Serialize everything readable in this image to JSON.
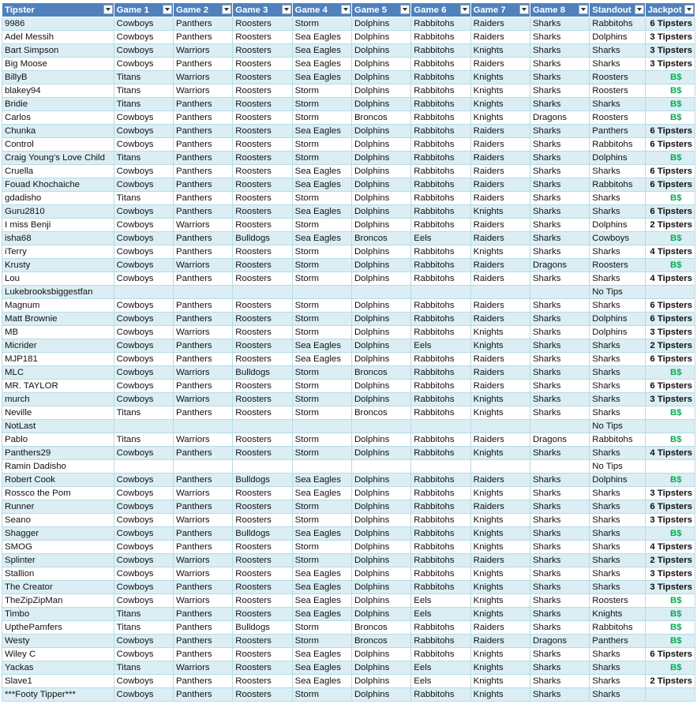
{
  "headers": [
    "Tipster",
    "Game 1",
    "Game 2",
    "Game 3",
    "Game 4",
    "Game 5",
    "Game 6",
    "Game 7",
    "Game 8",
    "Standout",
    "Jackpot"
  ],
  "rows": [
    [
      "9986",
      "Cowboys",
      "Panthers",
      "Roosters",
      "Storm",
      "Dolphins",
      "Rabbitohs",
      "Raiders",
      "Sharks",
      "Rabbitohs",
      "6 Tipsters"
    ],
    [
      "Adel Messih",
      "Cowboys",
      "Panthers",
      "Roosters",
      "Sea Eagles",
      "Dolphins",
      "Rabbitohs",
      "Raiders",
      "Sharks",
      "Dolphins",
      "3 Tipsters"
    ],
    [
      "Bart Simpson",
      "Cowboys",
      "Warriors",
      "Roosters",
      "Sea Eagles",
      "Dolphins",
      "Rabbitohs",
      "Knights",
      "Sharks",
      "Sharks",
      "3 Tipsters"
    ],
    [
      "Big Moose",
      "Cowboys",
      "Panthers",
      "Roosters",
      "Sea Eagles",
      "Dolphins",
      "Rabbitohs",
      "Raiders",
      "Sharks",
      "Sharks",
      "3 Tipsters"
    ],
    [
      "BillyB",
      "Titans",
      "Warriors",
      "Roosters",
      "Sea Eagles",
      "Dolphins",
      "Rabbitohs",
      "Knights",
      "Sharks",
      "Roosters",
      "B$"
    ],
    [
      "blakey94",
      "Titans",
      "Warriors",
      "Roosters",
      "Storm",
      "Dolphins",
      "Rabbitohs",
      "Knights",
      "Sharks",
      "Roosters",
      "B$"
    ],
    [
      "Bridie",
      "Titans",
      "Panthers",
      "Roosters",
      "Storm",
      "Dolphins",
      "Rabbitohs",
      "Knights",
      "Sharks",
      "Sharks",
      "B$"
    ],
    [
      "Carlos",
      "Cowboys",
      "Panthers",
      "Roosters",
      "Storm",
      "Broncos",
      "Rabbitohs",
      "Knights",
      "Dragons",
      "Roosters",
      "B$"
    ],
    [
      "Chunka",
      "Cowboys",
      "Panthers",
      "Roosters",
      "Sea Eagles",
      "Dolphins",
      "Rabbitohs",
      "Raiders",
      "Sharks",
      "Panthers",
      "6 Tipsters"
    ],
    [
      "Control",
      "Cowboys",
      "Panthers",
      "Roosters",
      "Storm",
      "Dolphins",
      "Rabbitohs",
      "Raiders",
      "Sharks",
      "Rabbitohs",
      "6 Tipsters"
    ],
    [
      "Craig Young's Love Child",
      "Titans",
      "Panthers",
      "Roosters",
      "Storm",
      "Dolphins",
      "Rabbitohs",
      "Raiders",
      "Sharks",
      "Dolphins",
      "B$"
    ],
    [
      "Cruella",
      "Cowboys",
      "Panthers",
      "Roosters",
      "Sea Eagles",
      "Dolphins",
      "Rabbitohs",
      "Raiders",
      "Sharks",
      "Sharks",
      "6 Tipsters"
    ],
    [
      "Fouad Khochaiche",
      "Cowboys",
      "Panthers",
      "Roosters",
      "Sea Eagles",
      "Dolphins",
      "Rabbitohs",
      "Raiders",
      "Sharks",
      "Rabbitohs",
      "6 Tipsters"
    ],
    [
      "gdadisho",
      "Titans",
      "Panthers",
      "Roosters",
      "Storm",
      "Dolphins",
      "Rabbitohs",
      "Raiders",
      "Sharks",
      "Sharks",
      "B$"
    ],
    [
      "Guru2810",
      "Cowboys",
      "Panthers",
      "Roosters",
      "Sea Eagles",
      "Dolphins",
      "Rabbitohs",
      "Knights",
      "Sharks",
      "Sharks",
      "6 Tipsters"
    ],
    [
      "I miss Benji",
      "Cowboys",
      "Warriors",
      "Roosters",
      "Storm",
      "Dolphins",
      "Rabbitohs",
      "Raiders",
      "Sharks",
      "Dolphins",
      "2 Tipsters"
    ],
    [
      "isha68",
      "Cowboys",
      "Panthers",
      "Bulldogs",
      "Sea Eagles",
      "Broncos",
      "Eels",
      "Raiders",
      "Sharks",
      "Cowboys",
      "B$"
    ],
    [
      "iTerry",
      "Cowboys",
      "Panthers",
      "Roosters",
      "Storm",
      "Dolphins",
      "Rabbitohs",
      "Knights",
      "Sharks",
      "Sharks",
      "4 Tipsters"
    ],
    [
      "Krusty",
      "Cowboys",
      "Warriors",
      "Roosters",
      "Storm",
      "Dolphins",
      "Rabbitohs",
      "Raiders",
      "Dragons",
      "Roosters",
      "B$"
    ],
    [
      "Lou",
      "Cowboys",
      "Panthers",
      "Roosters",
      "Storm",
      "Dolphins",
      "Rabbitohs",
      "Raiders",
      "Sharks",
      "Sharks",
      "4 Tipsters"
    ],
    [
      "Lukebrooksbiggestfan",
      "",
      "",
      "",
      "",
      "",
      "",
      "",
      "",
      "No Tips",
      ""
    ],
    [
      "Magnum",
      "Cowboys",
      "Panthers",
      "Roosters",
      "Storm",
      "Dolphins",
      "Rabbitohs",
      "Raiders",
      "Sharks",
      "Sharks",
      "6 Tipsters"
    ],
    [
      "Matt Brownie",
      "Cowboys",
      "Panthers",
      "Roosters",
      "Storm",
      "Dolphins",
      "Rabbitohs",
      "Raiders",
      "Sharks",
      "Dolphins",
      "6 Tipsters"
    ],
    [
      "MB",
      "Cowboys",
      "Warriors",
      "Roosters",
      "Storm",
      "Dolphins",
      "Rabbitohs",
      "Knights",
      "Sharks",
      "Dolphins",
      "3 Tipsters"
    ],
    [
      "Micrider",
      "Cowboys",
      "Panthers",
      "Roosters",
      "Sea Eagles",
      "Dolphins",
      "Eels",
      "Knights",
      "Sharks",
      "Sharks",
      "2 Tipsters"
    ],
    [
      "MJP181",
      "Cowboys",
      "Panthers",
      "Roosters",
      "Sea Eagles",
      "Dolphins",
      "Rabbitohs",
      "Raiders",
      "Sharks",
      "Sharks",
      "6 Tipsters"
    ],
    [
      "MLC",
      "Cowboys",
      "Warriors",
      "Bulldogs",
      "Storm",
      "Broncos",
      "Rabbitohs",
      "Raiders",
      "Sharks",
      "Sharks",
      "B$"
    ],
    [
      "MR. TAYLOR",
      "Cowboys",
      "Panthers",
      "Roosters",
      "Storm",
      "Dolphins",
      "Rabbitohs",
      "Raiders",
      "Sharks",
      "Sharks",
      "6 Tipsters"
    ],
    [
      "murch",
      "Cowboys",
      "Warriors",
      "Roosters",
      "Storm",
      "Dolphins",
      "Rabbitohs",
      "Knights",
      "Sharks",
      "Sharks",
      "3 Tipsters"
    ],
    [
      "Neville",
      "Titans",
      "Panthers",
      "Roosters",
      "Storm",
      "Broncos",
      "Rabbitohs",
      "Knights",
      "Sharks",
      "Sharks",
      "B$"
    ],
    [
      "NotLast",
      "",
      "",
      "",
      "",
      "",
      "",
      "",
      "",
      "No Tips",
      ""
    ],
    [
      "Pablo",
      "Titans",
      "Warriors",
      "Roosters",
      "Storm",
      "Dolphins",
      "Rabbitohs",
      "Raiders",
      "Dragons",
      "Rabbitohs",
      "B$"
    ],
    [
      "Panthers29",
      "Cowboys",
      "Panthers",
      "Roosters",
      "Storm",
      "Dolphins",
      "Rabbitohs",
      "Knights",
      "Sharks",
      "Sharks",
      "4 Tipsters"
    ],
    [
      "Ramin Dadisho",
      "",
      "",
      "",
      "",
      "",
      "",
      "",
      "",
      "No Tips",
      ""
    ],
    [
      "Robert Cook",
      "Cowboys",
      "Panthers",
      "Bulldogs",
      "Sea Eagles",
      "Dolphins",
      "Rabbitohs",
      "Raiders",
      "Sharks",
      "Dolphins",
      "B$"
    ],
    [
      "Rossco the Pom",
      "Cowboys",
      "Warriors",
      "Roosters",
      "Sea Eagles",
      "Dolphins",
      "Rabbitohs",
      "Knights",
      "Sharks",
      "Sharks",
      "3 Tipsters"
    ],
    [
      "Runner",
      "Cowboys",
      "Panthers",
      "Roosters",
      "Storm",
      "Dolphins",
      "Rabbitohs",
      "Raiders",
      "Sharks",
      "Sharks",
      "6 Tipsters"
    ],
    [
      "Seano",
      "Cowboys",
      "Warriors",
      "Roosters",
      "Storm",
      "Dolphins",
      "Rabbitohs",
      "Knights",
      "Sharks",
      "Sharks",
      "3 Tipsters"
    ],
    [
      "Shagger",
      "Cowboys",
      "Panthers",
      "Bulldogs",
      "Sea Eagles",
      "Dolphins",
      "Rabbitohs",
      "Knights",
      "Sharks",
      "Sharks",
      "B$"
    ],
    [
      "SMOG",
      "Cowboys",
      "Panthers",
      "Roosters",
      "Storm",
      "Dolphins",
      "Rabbitohs",
      "Knights",
      "Sharks",
      "Sharks",
      "4 Tipsters"
    ],
    [
      "Splinter",
      "Cowboys",
      "Warriors",
      "Roosters",
      "Storm",
      "Dolphins",
      "Rabbitohs",
      "Raiders",
      "Sharks",
      "Sharks",
      "2 Tipsters"
    ],
    [
      "Stallion",
      "Cowboys",
      "Warriors",
      "Roosters",
      "Sea Eagles",
      "Dolphins",
      "Rabbitohs",
      "Knights",
      "Sharks",
      "Sharks",
      "3 Tipsters"
    ],
    [
      "The Creator",
      "Cowboys",
      "Panthers",
      "Roosters",
      "Sea Eagles",
      "Dolphins",
      "Rabbitohs",
      "Knights",
      "Sharks",
      "Sharks",
      "3 Tipsters"
    ],
    [
      "TheZipZipMan",
      "Cowboys",
      "Warriors",
      "Roosters",
      "Sea Eagles",
      "Dolphins",
      "Eels",
      "Knights",
      "Sharks",
      "Roosters",
      "B$"
    ],
    [
      "Timbo",
      "Titans",
      "Panthers",
      "Roosters",
      "Sea Eagles",
      "Dolphins",
      "Eels",
      "Knights",
      "Sharks",
      "Knights",
      "B$"
    ],
    [
      "UpthePamfers",
      "Titans",
      "Panthers",
      "Bulldogs",
      "Storm",
      "Broncos",
      "Rabbitohs",
      "Raiders",
      "Sharks",
      "Rabbitohs",
      "B$"
    ],
    [
      "Westy",
      "Cowboys",
      "Panthers",
      "Roosters",
      "Storm",
      "Broncos",
      "Rabbitohs",
      "Raiders",
      "Dragons",
      "Panthers",
      "B$"
    ],
    [
      "Wiley C",
      "Cowboys",
      "Panthers",
      "Roosters",
      "Sea Eagles",
      "Dolphins",
      "Rabbitohs",
      "Knights",
      "Sharks",
      "Sharks",
      "6 Tipsters"
    ],
    [
      "Yackas",
      "Titans",
      "Warriors",
      "Roosters",
      "Sea Eagles",
      "Dolphins",
      "Eels",
      "Knights",
      "Sharks",
      "Sharks",
      "B$"
    ],
    [
      "Slave1",
      "Cowboys",
      "Panthers",
      "Roosters",
      "Sea Eagles",
      "Dolphins",
      "Eels",
      "Knights",
      "Sharks",
      "Sharks",
      "2 Tipsters"
    ],
    [
      "***Footy Tipper***",
      "Cowboys",
      "Panthers",
      "Roosters",
      "Storm",
      "Dolphins",
      "Rabbitohs",
      "Knights",
      "Sharks",
      "Sharks",
      ""
    ]
  ],
  "colors": {
    "header_bg": "#4f81bd",
    "band_bg": "#dbeef4",
    "bs_green": "#00b050"
  }
}
